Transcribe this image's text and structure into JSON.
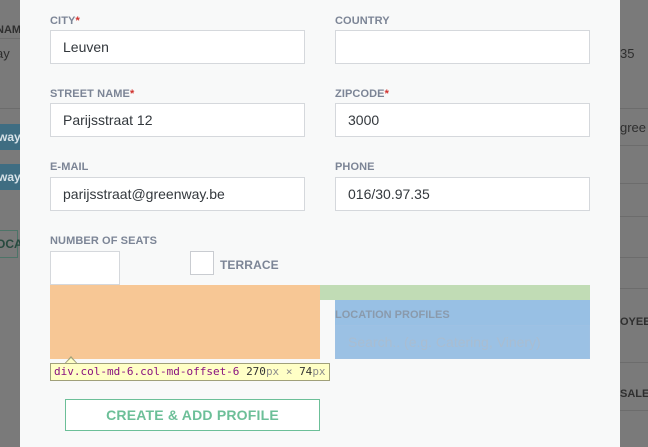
{
  "background": {
    "left_texts": [
      "NAM",
      "ay"
    ],
    "left_pills": [
      "way",
      "way"
    ],
    "left_outline": "OCA",
    "right_texts": [
      "35",
      "gree",
      "OYEE",
      "SALE"
    ]
  },
  "form": {
    "city": {
      "label": "CITY",
      "required": "*",
      "value": "Leuven"
    },
    "country": {
      "label": "COUNTRY",
      "value": ""
    },
    "street": {
      "label": "STREET NAME",
      "required": "*",
      "value": "Parijsstraat 12"
    },
    "zipcode": {
      "label": "ZIPCODE",
      "required": "*",
      "value": "3000"
    },
    "email": {
      "label": "E-MAIL",
      "value": "parijsstraat@greenway.be"
    },
    "phone": {
      "label": "PHONE",
      "value": "016/30.97.35"
    },
    "seats": {
      "label": "NUMBER OF SEATS",
      "value": ""
    },
    "terrace": {
      "label": "TERRACE",
      "checked": false
    },
    "location_profiles": {
      "label": "LOCATION PROFILES",
      "placeholder": "Search.. (e.g. Catering, Vinery)"
    },
    "create_button": "CREATE & ADD PROFILE"
  },
  "devtools_tooltip": {
    "selector": "div.col-md-6.col-md-offset-6",
    "width": "270",
    "unit": "px",
    "times": "×",
    "height": "74"
  },
  "colors": {
    "accent_green": "#6cbf98",
    "required_red": "#d0312d",
    "label_gray": "#7c8596"
  }
}
